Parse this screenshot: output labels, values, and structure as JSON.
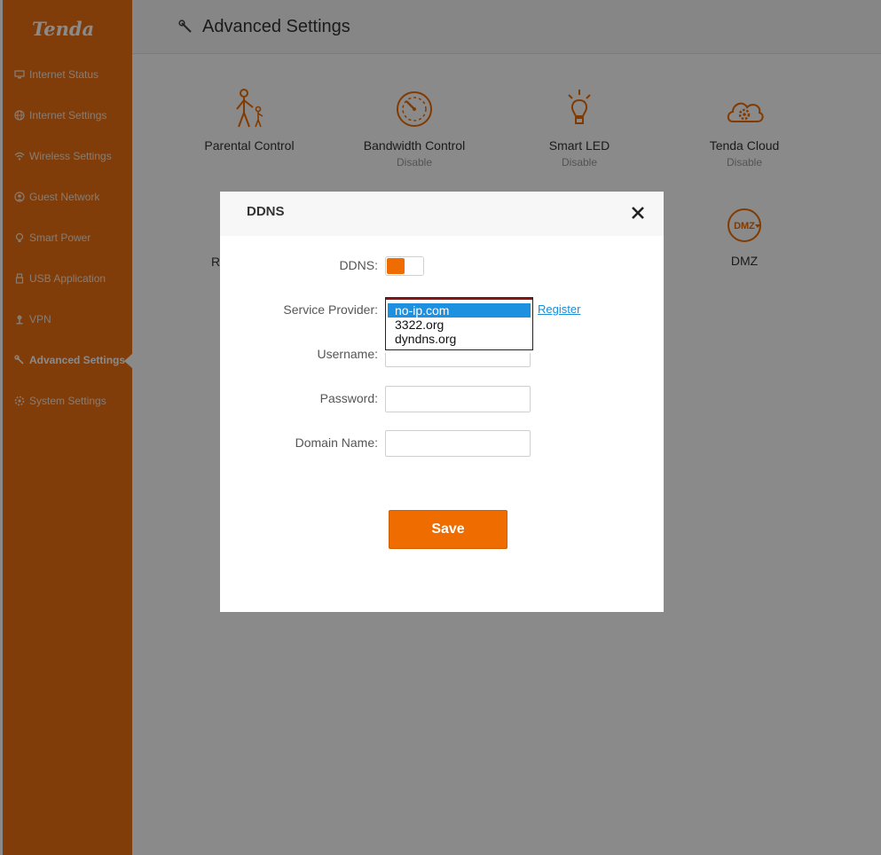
{
  "brand": {
    "logo_text": "Tenda",
    "accent_color": "#ed7114"
  },
  "sidebar": {
    "items": [
      {
        "label": "Internet Status",
        "icon": "monitor-icon"
      },
      {
        "label": "Internet Settings",
        "icon": "globe-icon"
      },
      {
        "label": "Wireless Settings",
        "icon": "wifi-icon"
      },
      {
        "label": "Guest Network",
        "icon": "guest-icon"
      },
      {
        "label": "Smart Power",
        "icon": "lightbulb-icon"
      },
      {
        "label": "USB Application",
        "icon": "usb-icon"
      },
      {
        "label": "VPN",
        "icon": "vpn-icon"
      },
      {
        "label": "Advanced Settings",
        "icon": "wrench-icon",
        "active": true
      },
      {
        "label": "System Settings",
        "icon": "gear-icon"
      }
    ]
  },
  "header": {
    "title": "Advanced Settings"
  },
  "tiles": [
    {
      "label": "Parental Control",
      "status": "",
      "icon": "parent-child-icon"
    },
    {
      "label": "Bandwidth Control",
      "status": "Disable",
      "icon": "speedometer-icon"
    },
    {
      "label": "Smart LED",
      "status": "Disable",
      "icon": "led-bulb-icon"
    },
    {
      "label": "Tenda Cloud",
      "status": "Disable",
      "icon": "cloud-gear-icon"
    },
    {
      "label": "DMZ",
      "status": "",
      "icon": "dmz-icon",
      "icon_text": "DMZ"
    }
  ],
  "partial_tile_letter": "R",
  "modal": {
    "title": "DDNS",
    "ddns_label": "DDNS:",
    "ddns_enabled": true,
    "service_provider_label": "Service Provider:",
    "service_provider_options": [
      "no-ip.com",
      "3322.org",
      "dyndns.org"
    ],
    "service_provider_selected": "no-ip.com",
    "register_link": "Register",
    "username_label": "Username:",
    "username_value": "",
    "password_label": "Password:",
    "password_value": "",
    "domain_label": "Domain Name:",
    "domain_value": "",
    "save_label": "Save"
  }
}
